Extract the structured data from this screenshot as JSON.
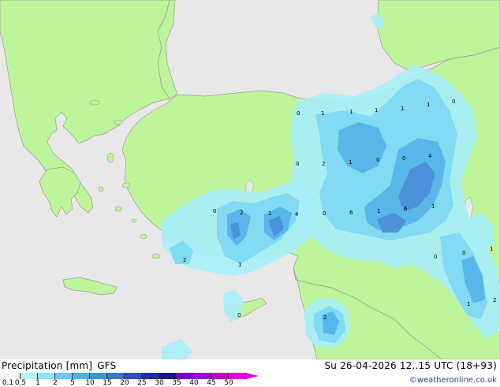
{
  "title": {
    "quantity": "Precipitation [mm]",
    "model": "GFS"
  },
  "run_info": "Su 26-04-2026 12..15 UTC (18+93)",
  "credit": "©weatheronline.co.uk",
  "colors": {
    "sea": "#e8e8e8",
    "land": "#bff59a",
    "coast": "#999999",
    "precip_light": "#a8eef7",
    "precip_mid": "#7fd8f2",
    "precip_heavy": "#55b4e8",
    "precip_max": "#4a8fd8"
  },
  "legend": {
    "scale_colors": [
      "#f5f5f5",
      "#b9f5f8",
      "#8ee6f5",
      "#6acbf0",
      "#4fb0e8",
      "#3f95dd",
      "#3b73cf",
      "#2f50b8",
      "#22309a",
      "#1a1a80",
      "#7a00c8",
      "#a000d0",
      "#c000c0",
      "#e000e0"
    ],
    "tick_labels": [
      "0.1",
      "0.5",
      "1",
      "2",
      "5",
      "10",
      "15",
      "20",
      "25",
      "30",
      "35",
      "40",
      "45",
      "50"
    ]
  },
  "precip_labels": [
    "0",
    "1",
    "1",
    "1",
    "1",
    "1",
    "0",
    "0",
    "2",
    "1",
    "0",
    "0",
    "4",
    "0",
    "2",
    "1",
    "4",
    "0",
    "6",
    "1",
    "6",
    "1",
    "2",
    "1",
    "0",
    "0",
    "1",
    "1",
    "0",
    "2",
    "2"
  ]
}
